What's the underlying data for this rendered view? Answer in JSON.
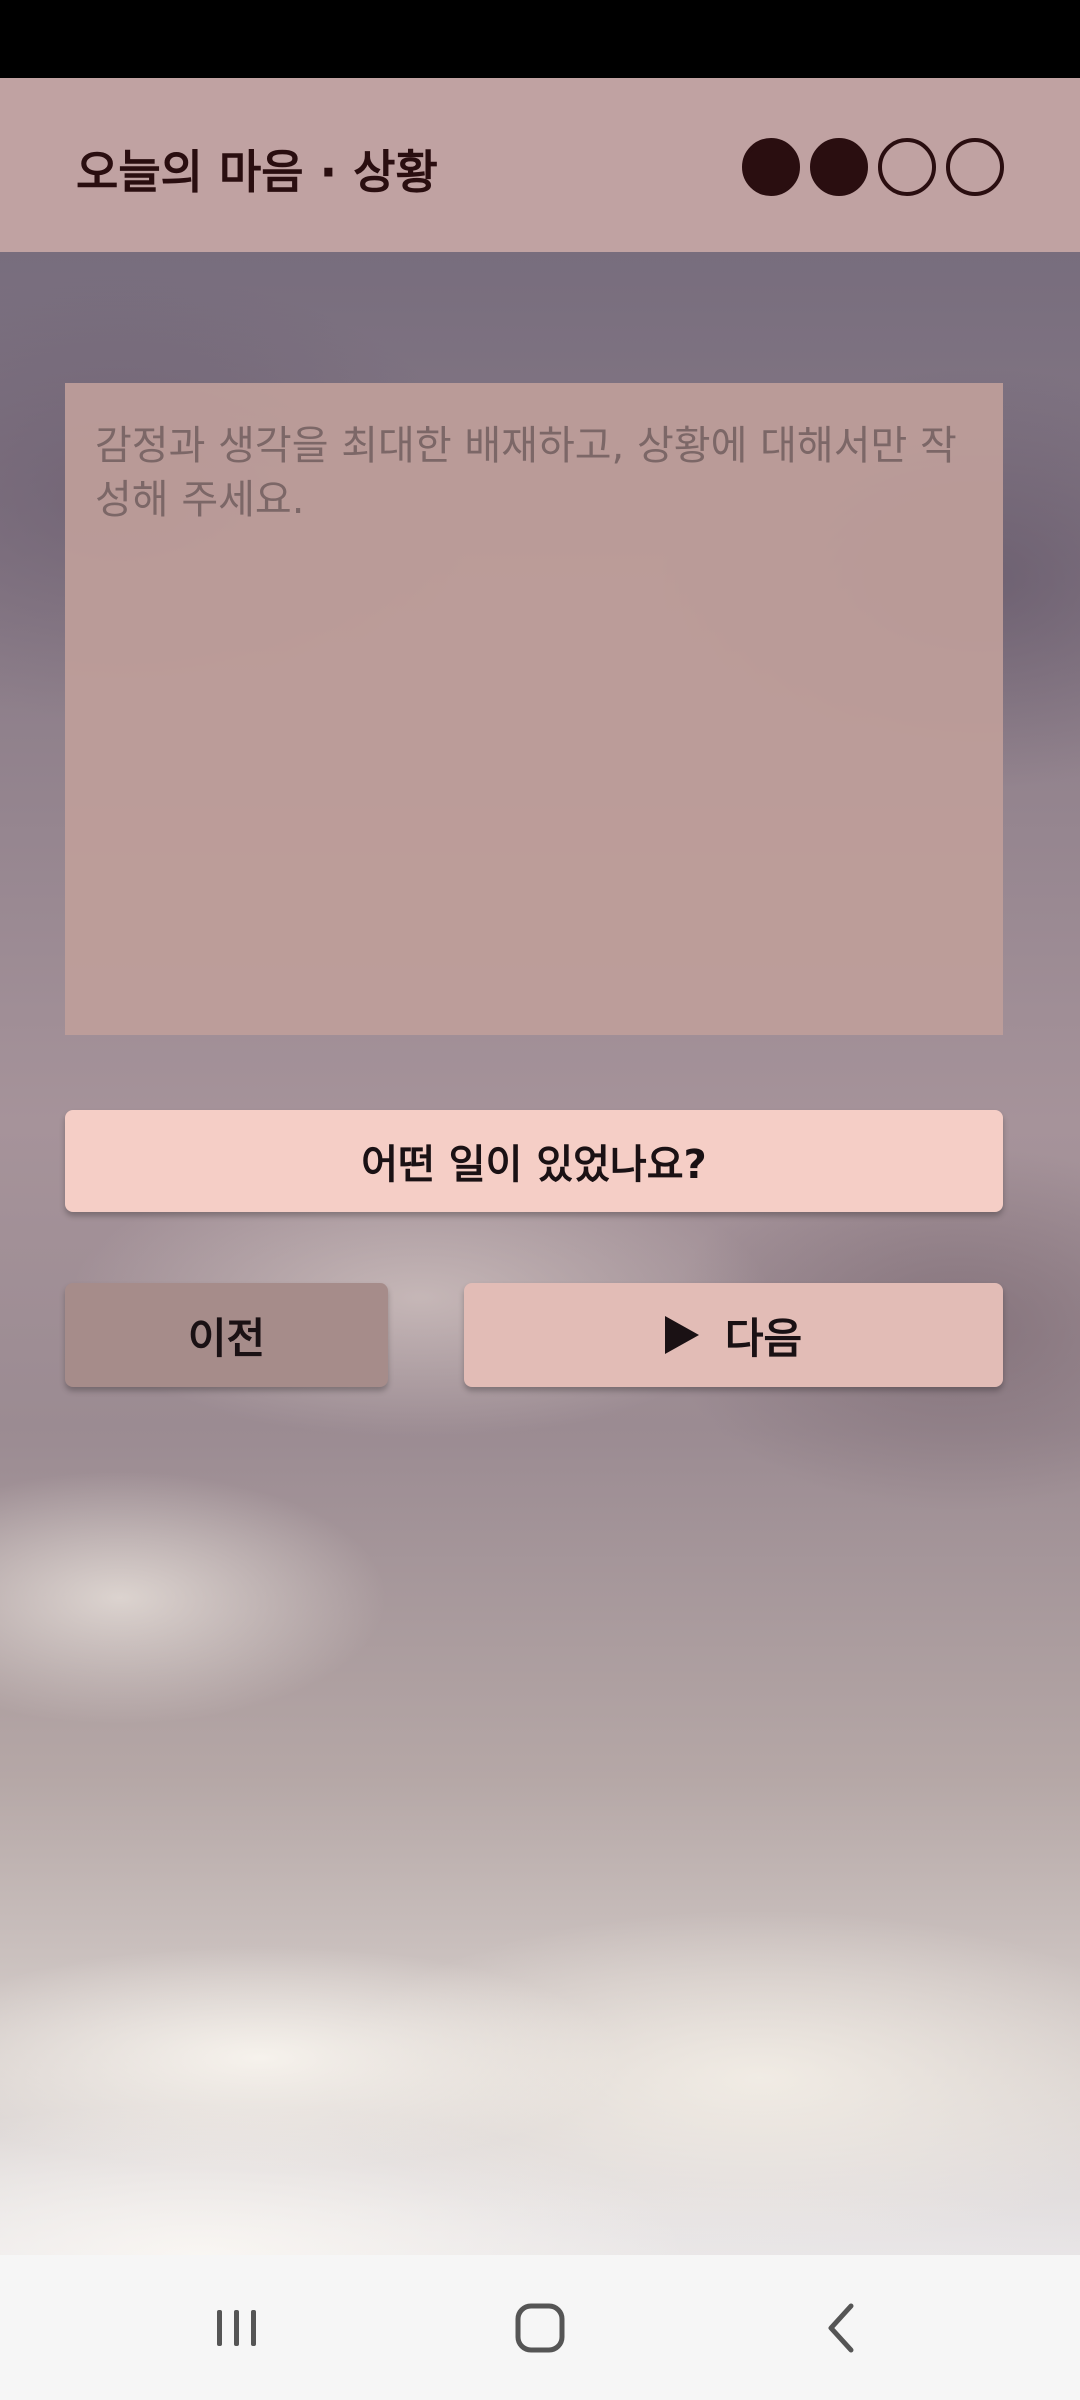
{
  "header": {
    "title": "오늘의 마음 · 상황",
    "progress": {
      "current_step": 2,
      "total_steps": 4
    }
  },
  "situation_input": {
    "placeholder": "감정과 생각을 최대한 배재하고, 상황에 대해서만 작성해 주세요.",
    "value": ""
  },
  "question_button": {
    "label": "어떤 일이 있었나요?"
  },
  "prev_button": {
    "label": "이전"
  },
  "next_button": {
    "label": "다음",
    "icon": "play-icon"
  },
  "nav_bar": {
    "icons": [
      "recent-apps-icon",
      "home-icon",
      "back-icon"
    ]
  },
  "colors": {
    "header_bg": "#c4a5a4",
    "text_dark": "#2a0e10",
    "question_button_bg": "#f5cec6",
    "prev_button_bg": "#a68c8a",
    "next_button_bg": "#e2bcb6"
  }
}
